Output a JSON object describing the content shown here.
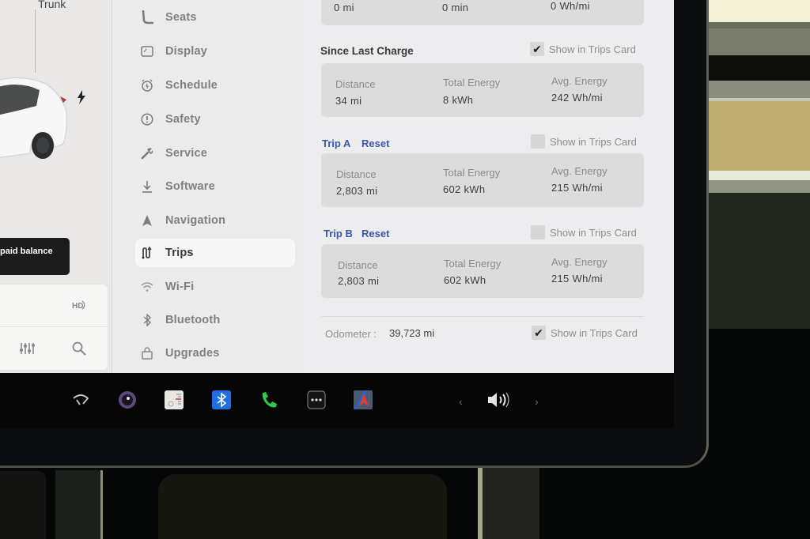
{
  "car_panel": {
    "trunk_label": "Trunk",
    "balance_toast": "paid balance",
    "media_icons": [
      "hd-radio-icon",
      "equalizer-icon",
      "search-icon"
    ]
  },
  "nav": {
    "items": [
      {
        "label": "Seats",
        "icon": "seat-icon",
        "active": false
      },
      {
        "label": "Display",
        "icon": "display-icon",
        "active": false
      },
      {
        "label": "Schedule",
        "icon": "alarm-clock-icon",
        "active": false
      },
      {
        "label": "Safety",
        "icon": "alert-circle-icon",
        "active": false
      },
      {
        "label": "Service",
        "icon": "wrench-icon",
        "active": false
      },
      {
        "label": "Software",
        "icon": "download-arrow-icon",
        "active": false
      },
      {
        "label": "Navigation",
        "icon": "navigation-arrow-icon",
        "active": false
      },
      {
        "label": "Trips",
        "icon": "trip-route-icon",
        "active": true
      },
      {
        "label": "Wi-Fi",
        "icon": "wifi-icon",
        "active": false
      },
      {
        "label": "Bluetooth",
        "icon": "bluetooth-icon",
        "active": false
      },
      {
        "label": "Upgrades",
        "icon": "shopping-bag-icon",
        "active": false
      }
    ]
  },
  "trips": {
    "current_drive": {
      "values": [
        "0 mi",
        "0 min",
        "0 Wh/mi"
      ]
    },
    "since_last_charge": {
      "title": "Since Last Charge",
      "show_in_trips_card": true,
      "labels": [
        "Distance",
        "Total Energy",
        "Avg. Energy"
      ],
      "values": [
        "34 mi",
        "8 kWh",
        "242 Wh/mi"
      ]
    },
    "trip_a": {
      "title": "Trip A",
      "reset_label": "Reset",
      "show_in_trips_card": false,
      "labels": [
        "Distance",
        "Total Energy",
        "Avg. Energy"
      ],
      "values": [
        "2,803 mi",
        "602 kWh",
        "215 Wh/mi"
      ]
    },
    "trip_b": {
      "title": "Trip B",
      "reset_label": "Reset",
      "show_in_trips_card": false,
      "labels": [
        "Distance",
        "Total Energy",
        "Avg. Energy"
      ],
      "values": [
        "2,803 mi",
        "602 kWh",
        "215 Wh/mi"
      ]
    },
    "show_in_trips_card_label": "Show in Trips Card",
    "odometer": {
      "label": "Odometer :",
      "value": "39,723 mi",
      "show_in_trips_card": true
    },
    "checkmark": "✔"
  },
  "taskbar": {
    "icons": [
      "wiper-icon",
      "camera-icon",
      "energy-app-icon",
      "bluetooth-app-icon",
      "phone-icon",
      "more-apps-icon",
      "navigation-app-icon"
    ],
    "volume_prev": "‹",
    "volume_next": "›",
    "volume_icon": "volume-icon"
  },
  "colors": {
    "accent_link": "#3b56a8",
    "bluetooth_tile": "#1f6fe0",
    "phone_green": "#2ec84a"
  }
}
